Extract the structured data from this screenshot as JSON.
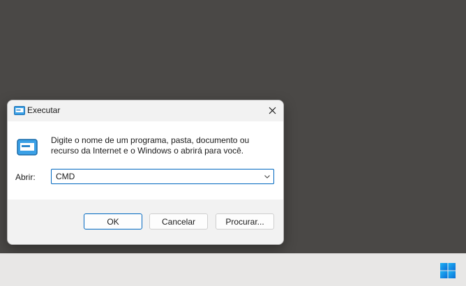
{
  "dialog": {
    "title": "Executar",
    "description_line1": "Digite o nome de um programa, pasta, documento ou",
    "description_line2": "recurso da Internet e o Windows o abrirá para você.",
    "open_label": "Abrir:",
    "open_value": "CMD",
    "buttons": {
      "ok": "OK",
      "cancel": "Cancelar",
      "browse": "Procurar..."
    },
    "icons": {
      "title": "run-app-icon",
      "body": "run-app-icon",
      "close": "close-icon",
      "dropdown": "chevron-down-icon"
    }
  },
  "taskbar": {
    "start_icon": "windows-logo-icon"
  },
  "colors": {
    "desktop": "#4a4846",
    "accent": "#0067c0",
    "taskbar": "#e8e7e6"
  }
}
